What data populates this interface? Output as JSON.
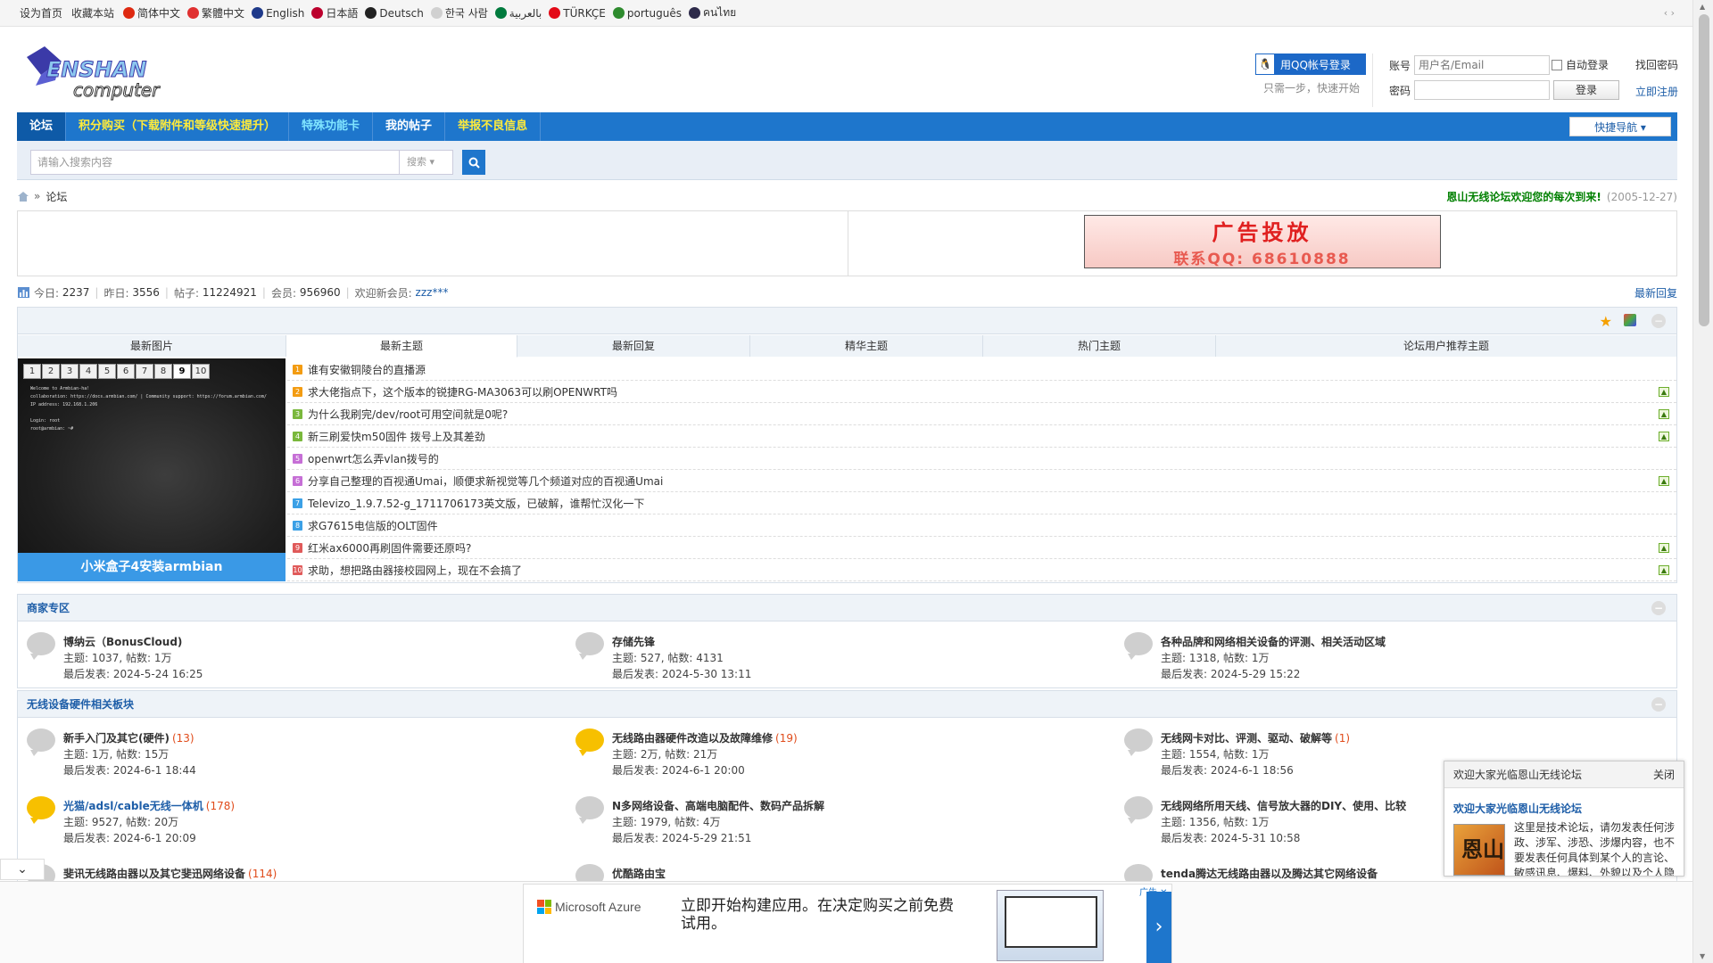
{
  "topbar": {
    "links": [
      "设为首页",
      "收藏本站"
    ],
    "languages": [
      {
        "label": "简体中文",
        "color": "#de2910"
      },
      {
        "label": "繁體中文",
        "color": "#e03030"
      },
      {
        "label": "English",
        "color": "#1f3a8a"
      },
      {
        "label": "日本語",
        "color": "#bc002d"
      },
      {
        "label": "Deutsch",
        "color": "#222222"
      },
      {
        "label": "한국 사람",
        "color": "#d0d0d0"
      },
      {
        "label": "بالعربية",
        "color": "#007a3d"
      },
      {
        "label": "TÜRKÇE",
        "color": "#e30a17"
      },
      {
        "label": "português",
        "color": "#2e8b2e"
      },
      {
        "label": "คนไทย",
        "color": "#2d2a4a"
      }
    ],
    "switch": "‹ ›"
  },
  "header": {
    "logo_text_1": "ENSHAN",
    "logo_text_2": "computer",
    "qq_login": "用QQ帐号登录",
    "qq_tip": "只需一步，快速开始",
    "account_label": "账号",
    "account_placeholder": "用户名/Email",
    "password_label": "密码",
    "auto_login": "自动登录",
    "login_button": "登录",
    "forgot": "找回密码",
    "register": "立即注册"
  },
  "nav": {
    "items": [
      "论坛",
      "积分购买（下载附件和等级快速提升）",
      "特殊功能卡",
      "我的帖子",
      "举报不良信息"
    ],
    "quick": "快捷导航 ▾"
  },
  "search": {
    "placeholder": "请输入搜索内容",
    "scope": "搜索 ▾"
  },
  "breadcrumb": {
    "sep": "»",
    "current": "论坛",
    "welcome": "恩山无线论坛欢迎您的每次到来!",
    "date": "(2005-12-27)"
  },
  "ad": {
    "line1": "广告投放",
    "line2": "联系QQ: 68610888"
  },
  "stats": {
    "today_label": "今日:",
    "today": "2237",
    "yesterday_label": "昨日:",
    "yesterday": "3556",
    "posts_label": "帖子:",
    "posts": "11224921",
    "members_label": "会员:",
    "members": "956960",
    "newmember_label": "欢迎新会员:",
    "newmember": "zzz***",
    "latest_reply": "最新回复"
  },
  "portal": {
    "tabs": [
      "最新图片",
      "最新主题",
      "最新回复",
      "精华主题",
      "热门主题",
      "论坛用户推荐主题"
    ],
    "pic_pages": [
      "1",
      "2",
      "3",
      "4",
      "5",
      "6",
      "7",
      "8",
      "9",
      "10"
    ],
    "pic_caption": "小米盒子4安装armbian",
    "terminal": "Welcome to Armbian-ha!\ncollaboration: https://docs.armbian.com/ | Community support: https://forum.armbian.com/\nIP address: 192.168.1.206\n\nLogin: root\nroot@armbian: ~#",
    "topics": [
      {
        "title": "谁有安徽铜陵台的直播源",
        "color": "#f39c12",
        "attach": false
      },
      {
        "title": "求大佬指点下，这个版本的锐捷RG-MA3063可以刷OPENWRT吗",
        "color": "#f39c12",
        "attach": true
      },
      {
        "title": "为什么我刷完/dev/root可用空间就是0呢?",
        "color": "#7ab83c",
        "attach": true
      },
      {
        "title": "新三刷爱快m50固件 拨号上及其差劲",
        "color": "#7ab83c",
        "attach": true
      },
      {
        "title": "openwrt怎么弄vlan拨号的",
        "color": "#c66fd6",
        "attach": false
      },
      {
        "title": "分享自己整理的百视通Umai，顺便求新视觉等几个频道对应的百视通Umai",
        "color": "#c66fd6",
        "attach": true
      },
      {
        "title": "Televizo_1.9.7.52-g_1711706173英文版，已破解，谁帮忙汉化一下",
        "color": "#3ba0e6",
        "attach": false
      },
      {
        "title": "求G7615电信版的OLT固件",
        "color": "#3ba0e6",
        "attach": false
      },
      {
        "title": "红米ax6000再刷固件需要还原吗?",
        "color": "#e05a5a",
        "attach": true
      },
      {
        "title": "求助，想把路由器接校园网上，现在不会搞了",
        "color": "#e05a5a",
        "attach": true
      }
    ],
    "topic_numbers": [
      "1",
      "2",
      "3",
      "4",
      "5",
      "6",
      "7",
      "8",
      "9",
      "10"
    ]
  },
  "sections": [
    {
      "title": "商家专区",
      "forums": [
        {
          "name": "博纳云（BonusCloud)",
          "count": "",
          "topics": "主题: 1037, 帖数: 1万",
          "last": "最后发表: 2024-5-24 16:25",
          "new": false
        },
        {
          "name": "存储先锋",
          "count": "",
          "topics": "主题: 527, 帖数: 4131",
          "last": "最后发表: 2024-5-30 13:11",
          "new": false
        },
        {
          "name": "各种品牌和网络相关设备的评测、相关活动区域",
          "count": "",
          "topics": "主题: 1318, 帖数: 1万",
          "last": "最后发表: 2024-5-29 15:22",
          "new": false
        }
      ]
    },
    {
      "title": "无线设备硬件相关板块",
      "forums": [
        {
          "name": "新手入门及其它(硬件)",
          "count": "(13)",
          "topics": "主题: 1万, 帖数: 15万",
          "last": "最后发表: 2024-6-1 18:44",
          "new": false
        },
        {
          "name": "无线路由器硬件改造以及故障维修",
          "count": "(19)",
          "topics": "主题: 2万, 帖数: 21万",
          "last": "最后发表: 2024-6-1 20:00",
          "new": true
        },
        {
          "name": "无线网卡对比、评测、驱动、破解等",
          "count": "(1)",
          "topics": "主题: 1554, 帖数: 1万",
          "last": "最后发表: 2024-6-1 18:56",
          "new": false
        },
        {
          "name": "光猫/adsl/cable无线一体机",
          "count": "(178)",
          "topics": "主题: 9527, 帖数: 20万",
          "last": "最后发表: 2024-6-1 20:09",
          "new": true,
          "blue": true
        },
        {
          "name": "N多网络设备、高端电脑配件、数码产品拆解",
          "count": "",
          "topics": "主题: 1979, 帖数: 4万",
          "last": "最后发表: 2024-5-29 21:51",
          "new": false
        },
        {
          "name": "无线网络所用天线、信号放大器的DIY、使用、比较",
          "count": "",
          "topics": "主题: 1356, 帖数: 1万",
          "last": "最后发表: 2024-5-31 10:58",
          "new": false
        },
        {
          "name": "斐讯无线路由器以及其它斐迅网络设备",
          "count": "(114)",
          "topics": "",
          "last": "",
          "new": false
        },
        {
          "name": "优酷路由宝",
          "count": "",
          "topics": "",
          "last": "",
          "new": false
        },
        {
          "name": "tenda腾达无线路由器以及腾达其它网络设备",
          "count": "",
          "topics": "",
          "last": "",
          "new": false
        }
      ]
    }
  ],
  "popup": {
    "header": "欢迎大家光临恩山无线论坛",
    "close": "关闭",
    "title": "欢迎大家光临恩山无线论坛",
    "img_glyph": "恩山",
    "text": "这里是技术论坛，请勿发表任何涉政、涉军、涉恐、涉爆内容，也不要发表任何具体到某个人的言论、敏感讯息、爆料、外貌以及个人隐"
  },
  "expand_icon": "⌄",
  "bottom_ad": {
    "brand": "Microsoft Azure",
    "message": "立即开始构建应用。在决定购买之前免费试用。",
    "badge": "广告 ✕",
    "arrow": "›"
  }
}
